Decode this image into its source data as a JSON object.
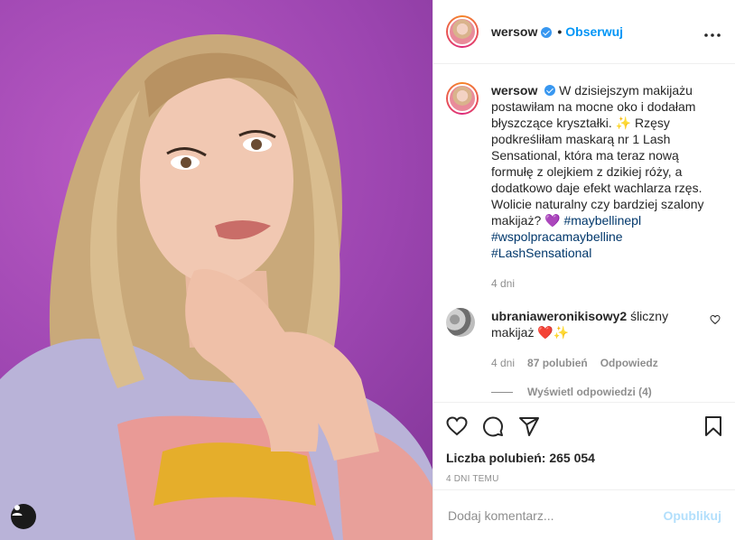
{
  "post": {
    "username": "wersow",
    "follow_label": "Obserwuj",
    "dot": "•",
    "more_label": "•••"
  },
  "caption": {
    "username": "wersow",
    "text_1": "W dzisiejszym makijażu postawiłam na mocne oko i dodałam błyszczące kryształki. ✨ Rzęsy podkreśliłam maskarą nr 1 Lash Sensational, która ma teraz nową formułę z olejkiem z dzikiej róży, a dodatkowo daje efekt wachlarza rzęs. Wolicie naturalny czy bardziej szalony makijaż? 💜",
    "hashtags": [
      "#maybellinepl",
      "#wspolpracamaybelline",
      "#LashSensational"
    ],
    "age": "4 dni"
  },
  "comment": {
    "username": "ubraniaweronikisowy2",
    "text": "śliczny makijaż ❤️✨",
    "age": "4 dni",
    "likes": "87 polubień",
    "reply": "Odpowiedz",
    "view_replies": "Wyświetl odpowiedzi (4)"
  },
  "actions": {
    "likes_label": "Liczba polubień: 265 054",
    "timestamp": "4 DNI TEMU"
  },
  "add_comment": {
    "placeholder": "Dodaj komentarz...",
    "publish": "Opublikuj"
  },
  "colors": {
    "accent": "#0095f6",
    "publish_disabled": "#b2dffc",
    "photo_background": "#a64cbd"
  },
  "icons": [
    "user-tag-icon",
    "verified-icon",
    "more-icon",
    "heart-icon",
    "comment-icon",
    "share-icon",
    "save-icon"
  ]
}
